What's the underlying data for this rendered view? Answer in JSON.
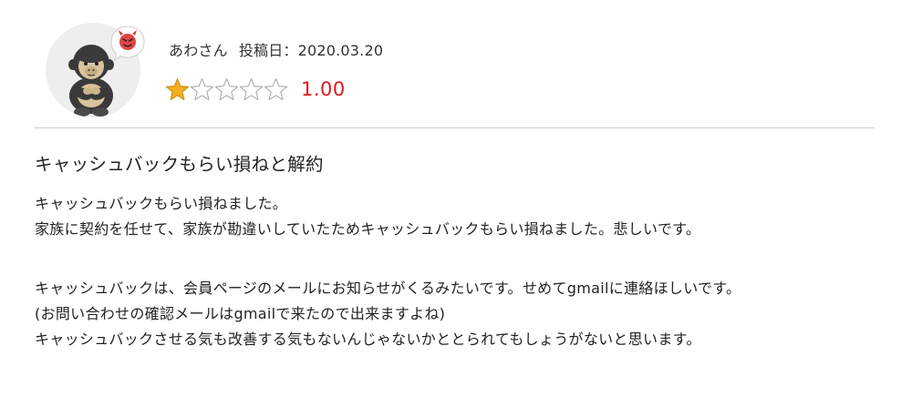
{
  "reviewer": {
    "name": "あわさん",
    "date_label": "投稿日：2020.03.20",
    "avatar_icon": "gorilla-avatar-icon",
    "badge_icon": "devil-face-icon"
  },
  "rating": {
    "value": 1,
    "max": 5,
    "display": "1.00",
    "star_color": "#f2b01e",
    "score_color": "#e01818"
  },
  "review": {
    "title": "キャッシュバックもらい損ねと解約",
    "lines": [
      "キャッシュバックもらい損ねました。",
      "家族に契約を任せて、家族が勘違いしていたためキャッシュバックもらい損ねました。悲しいです。",
      "",
      "キャッシュバックは、会員ページのメールにお知らせがくるみたいです。せめてgmailに連絡ほしいです。",
      "(お問い合わせの確認メールはgmailで来たので出来ますよね)",
      "キャッシュバックさせる気も改善する気もないんじゃないかととられてもしょうがないと思います。"
    ]
  }
}
